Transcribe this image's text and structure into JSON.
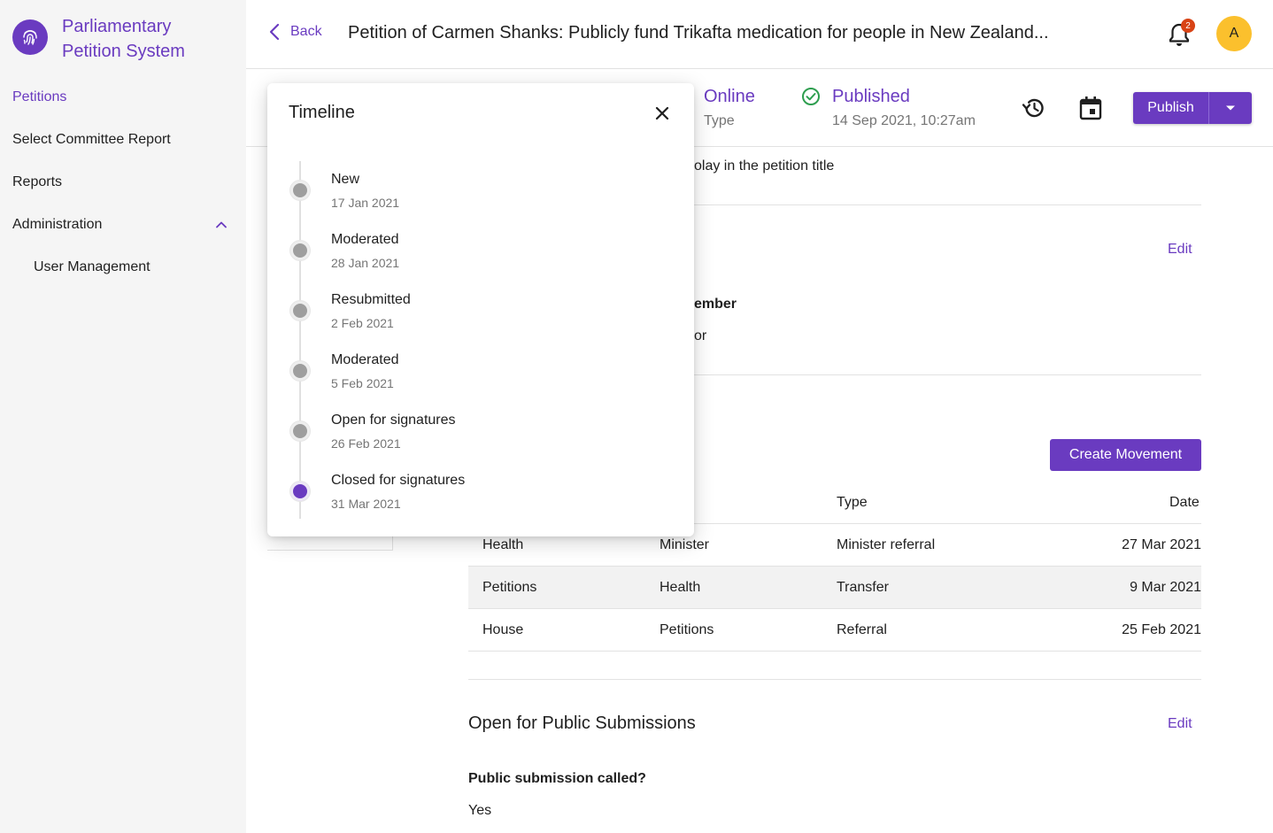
{
  "app": {
    "title": "Parliamentary Petition System",
    "logo_icon": "fingerprint-icon",
    "accent": "#6a3bc0"
  },
  "sidebar": {
    "items": [
      {
        "label": "Petitions",
        "active": true
      },
      {
        "label": "Select Committee Report"
      },
      {
        "label": "Reports"
      },
      {
        "label": "Administration",
        "expanded": true
      },
      {
        "label": "User Management",
        "sub": true
      }
    ]
  },
  "header": {
    "back_label": "Back",
    "title": "Petition of Carmen Shanks: Publicly fund Trikafta medication for people in New Zealand...",
    "notification_count": "2",
    "avatar_initial": "A"
  },
  "status": {
    "type_value": "Online",
    "type_label": "Type",
    "state_value": "Published",
    "state_date": "14 Sep 2021, 10:27am",
    "publish_label": "Publish"
  },
  "content": {
    "title_hint_fragment": "olay in the petition title",
    "edit_label": "Edit",
    "member_fragment": "ember",
    "member_value_fragment": "or",
    "create_movement_label": "Create Movement",
    "movements": {
      "headers": {
        "type": "Type",
        "date": "Date"
      },
      "rows": [
        {
          "from": "Health",
          "to": "Minister",
          "type": "Minister referral",
          "date": "27 Mar 2021"
        },
        {
          "from": "Petitions",
          "to": "Health",
          "type": "Transfer",
          "date": "9 Mar 2021"
        },
        {
          "from": "House",
          "to": "Petitions",
          "type": "Referral",
          "date": "25 Feb 2021"
        }
      ]
    },
    "public_submissions": {
      "title": "Open for Public Submissions",
      "edit_label": "Edit",
      "question": "Public submission called?",
      "answer": "Yes"
    }
  },
  "timeline": {
    "title": "Timeline",
    "events": [
      {
        "label": "New",
        "date": "17 Jan 2021"
      },
      {
        "label": "Moderated",
        "date": "28 Jan 2021"
      },
      {
        "label": "Resubmitted",
        "date": "2 Feb 2021"
      },
      {
        "label": "Moderated",
        "date": "5 Feb 2021"
      },
      {
        "label": "Open for signatures",
        "date": "26 Feb 2021"
      },
      {
        "label": "Closed for signatures",
        "date": "31 Mar 2021",
        "current": true
      }
    ]
  }
}
